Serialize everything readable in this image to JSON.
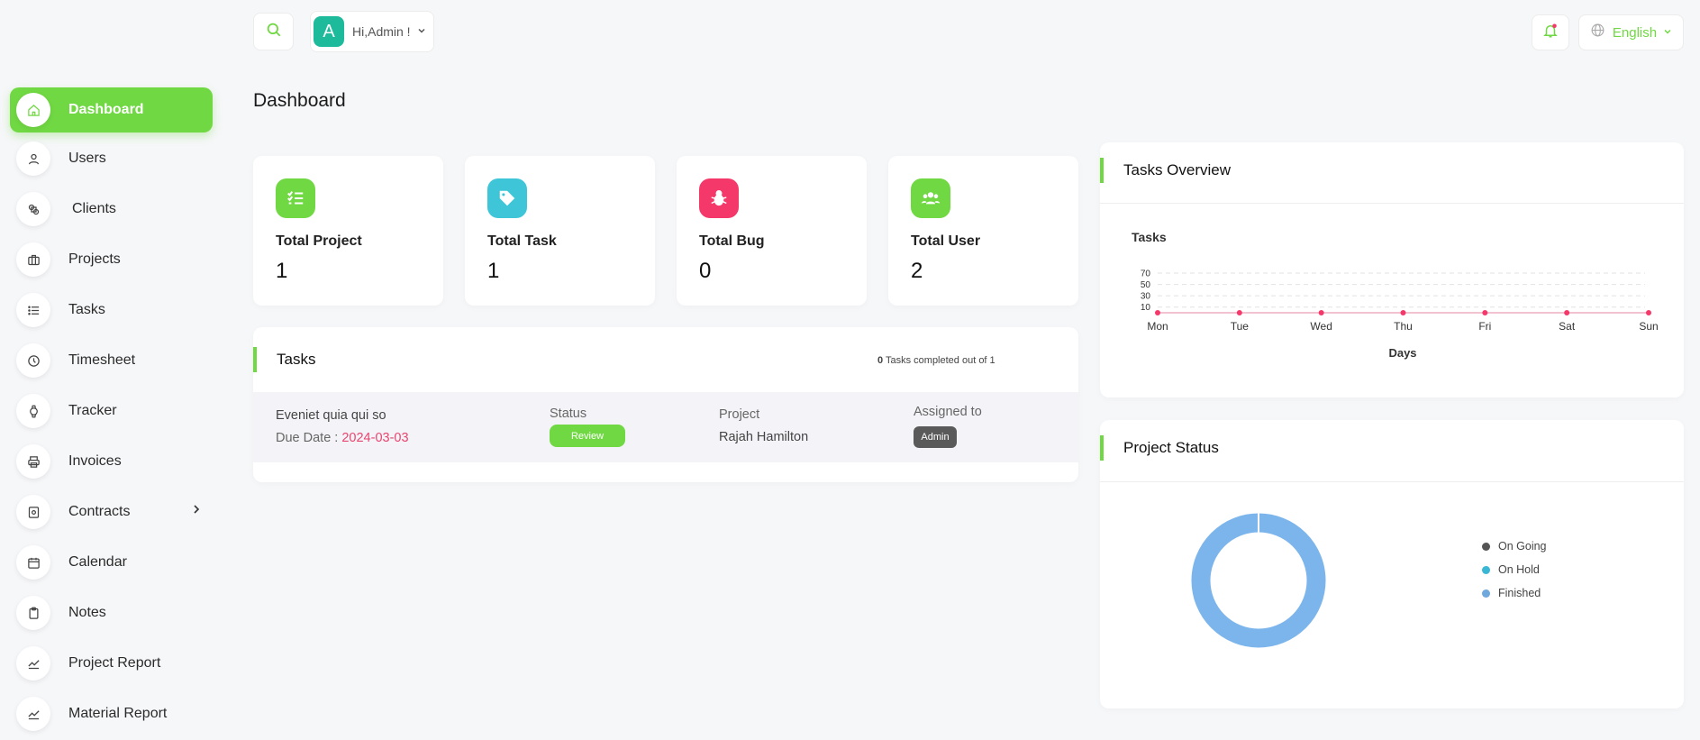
{
  "header": {
    "greeting": "Hi,Admin !",
    "avatar_letter": "A",
    "language": "English"
  },
  "page_title": "Dashboard",
  "sidebar": {
    "items": [
      {
        "label": "Dashboard",
        "icon": "home-icon",
        "active": true
      },
      {
        "label": "Users",
        "icon": "user-icon"
      },
      {
        "label": "Clients",
        "icon": "clients-icon"
      },
      {
        "label": "Projects",
        "icon": "projects-icon"
      },
      {
        "label": "Tasks",
        "icon": "list-icon"
      },
      {
        "label": "Timesheet",
        "icon": "clock-icon"
      },
      {
        "label": "Tracker",
        "icon": "watch-icon"
      },
      {
        "label": "Invoices",
        "icon": "printer-icon"
      },
      {
        "label": "Contracts",
        "icon": "contract-icon"
      },
      {
        "label": "Calendar",
        "icon": "calendar-icon"
      },
      {
        "label": "Notes",
        "icon": "clipboard-icon"
      },
      {
        "label": "Project Report",
        "icon": "chart-line-icon"
      },
      {
        "label": "Material Report",
        "icon": "chart-line-icon"
      }
    ]
  },
  "stats": [
    {
      "label": "Total Project",
      "value": "1",
      "color": "#70d843",
      "icon": "checklist-icon"
    },
    {
      "label": "Total Task",
      "value": "1",
      "color": "#3ec6d8",
      "icon": "tag-icon"
    },
    {
      "label": "Total Bug",
      "value": "0",
      "color": "#f5386a",
      "icon": "bug-icon"
    },
    {
      "label": "Total User",
      "value": "2",
      "color": "#70d843",
      "icon": "users-icon"
    }
  ],
  "tasks": {
    "title": "Tasks",
    "completed_count": "0",
    "completed_text": "Tasks completed out of 1",
    "rows": [
      {
        "name": "Eveniet quia qui so",
        "due_label": "Due Date :",
        "due_date": "2024-03-03",
        "status_label": "Status",
        "status": "Review",
        "project_label": "Project",
        "project": "Rajah Hamilton",
        "assigned_label": "Assigned to",
        "assigned": "Admin"
      }
    ]
  },
  "tasks_overview": {
    "title": "Tasks Overview"
  },
  "project_status": {
    "title": "Project Status"
  },
  "chart_data": [
    {
      "type": "line",
      "title": "Tasks",
      "xlabel": "Days",
      "ylabel": "",
      "categories": [
        "Mon",
        "Tue",
        "Wed",
        "Thu",
        "Fri",
        "Sat",
        "Sun"
      ],
      "y_ticks": [
        "70",
        "50",
        "30",
        "10"
      ],
      "ylim": [
        0,
        70
      ],
      "series": [
        {
          "values": [
            0,
            0,
            0,
            0,
            0,
            0,
            0
          ],
          "color": "#f5386a"
        }
      ],
      "grid": true
    },
    {
      "type": "pie",
      "labels": [
        "On Going",
        "On Hold",
        "Finished"
      ],
      "values": [
        0,
        0,
        1
      ],
      "colors": [
        "#555555",
        "#3ab7d4",
        "#6fa8dc"
      ],
      "ring_color": "#7cb5ec",
      "legend": "right"
    }
  ]
}
